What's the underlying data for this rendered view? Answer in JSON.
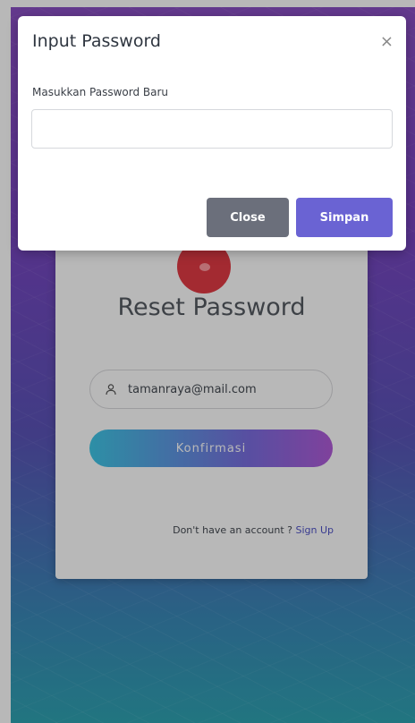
{
  "modal": {
    "title": "Input Password",
    "close_icon": "×",
    "field_label": "Masukkan Password Baru",
    "field_value": "",
    "close_button": "Close",
    "save_button": "Simpan"
  },
  "card": {
    "title": "Reset Password",
    "email": "tamanraya@mail.com",
    "confirm_button": "Konfirmasi",
    "signup_prompt": "Don't have an account ? ",
    "signup_link": "Sign Up"
  },
  "colors": {
    "primary": "#6a63d3",
    "secondary": "#6b6f7b",
    "logo": "#e23b45",
    "gradient_start": "#3fc7e6",
    "gradient_end": "#b15bd9"
  },
  "icons": {
    "user": "user-icon",
    "close": "close-icon",
    "logo": "logo-icon"
  }
}
